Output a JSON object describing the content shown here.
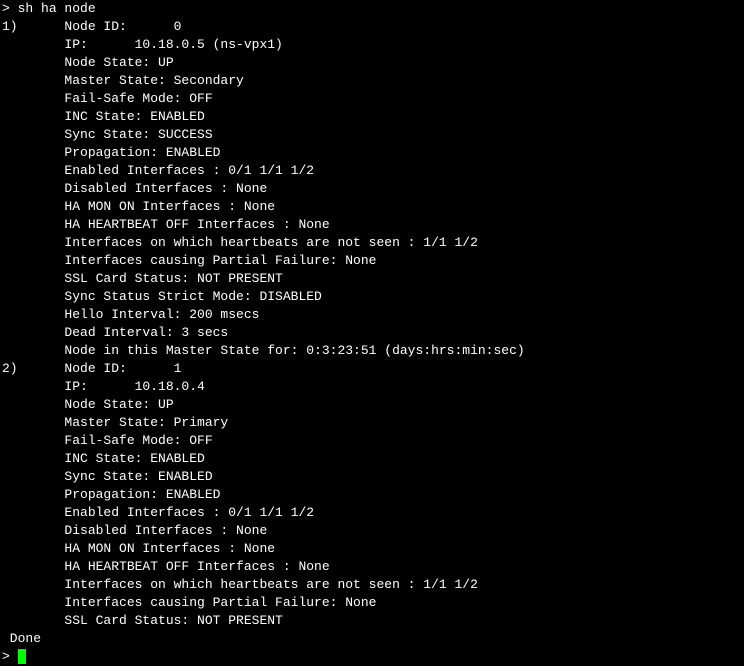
{
  "cmd_prompt": ">",
  "command": "sh ha node",
  "rows": [
    "1)      Node ID:      0",
    "        IP:      10.18.0.5 (ns-vpx1)",
    "        Node State: UP",
    "        Master State: Secondary",
    "        Fail-Safe Mode: OFF",
    "        INC State: ENABLED",
    "        Sync State: SUCCESS",
    "        Propagation: ENABLED",
    "        Enabled Interfaces : 0/1 1/1 1/2",
    "        Disabled Interfaces : None",
    "        HA MON ON Interfaces : None",
    "        HA HEARTBEAT OFF Interfaces : None",
    "        Interfaces on which heartbeats are not seen : 1/1 1/2",
    "        Interfaces causing Partial Failure: None",
    "        SSL Card Status: NOT PRESENT",
    "        Sync Status Strict Mode: DISABLED",
    "        Hello Interval: 200 msecs",
    "        Dead Interval: 3 secs",
    "        Node in this Master State for: 0:3:23:51 (days:hrs:min:sec)",
    "2)      Node ID:      1",
    "        IP:      10.18.0.4",
    "        Node State: UP",
    "        Master State: Primary",
    "        Fail-Safe Mode: OFF",
    "        INC State: ENABLED",
    "        Sync State: ENABLED",
    "        Propagation: ENABLED",
    "        Enabled Interfaces : 0/1 1/1 1/2",
    "        Disabled Interfaces : None",
    "        HA MON ON Interfaces : None",
    "        HA HEARTBEAT OFF Interfaces : None",
    "        Interfaces on which heartbeats are not seen : 1/1 1/2",
    "        Interfaces causing Partial Failure: None",
    "        SSL Card Status: NOT PRESENT"
  ],
  "done": " Done"
}
